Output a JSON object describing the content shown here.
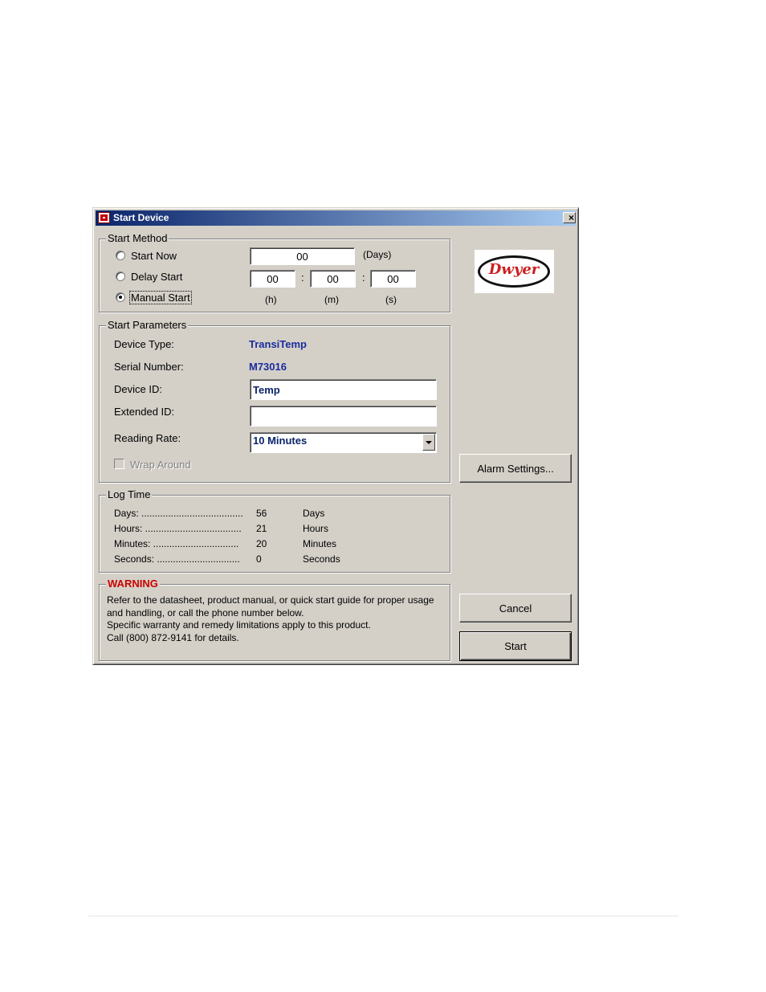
{
  "window": {
    "title": "Start Device",
    "close_label": "×"
  },
  "logo": {
    "text": "Dwyer"
  },
  "start_method": {
    "legend": "Start Method",
    "options": [
      {
        "label": "Start Now",
        "checked": false
      },
      {
        "label": "Delay Start",
        "checked": false
      },
      {
        "label": "Manual Start",
        "checked": true
      }
    ],
    "days_value": "00",
    "days_unit": "(Days)",
    "hours_value": "00",
    "minutes_value": "00",
    "seconds_value": "00",
    "colon": ":",
    "hours_unit": "(h)",
    "minutes_unit": "(m)",
    "seconds_unit": "(s)"
  },
  "start_parameters": {
    "legend": "Start Parameters",
    "device_type_label": "Device Type:",
    "device_type_value": "TransiTemp",
    "serial_label": "Serial Number:",
    "serial_value": "M73016",
    "device_id_label": "Device ID:",
    "device_id_value": "Temp",
    "extended_id_label": "Extended ID:",
    "extended_id_value": "",
    "reading_rate_label": "Reading Rate:",
    "reading_rate_value": "10 Minutes",
    "wrap_around_label": "Wrap Around"
  },
  "log_time": {
    "legend": "Log Time",
    "rows": [
      {
        "label": "Days: ......................................",
        "value": "56",
        "unit": "Days"
      },
      {
        "label": "Hours: ....................................",
        "value": "21",
        "unit": "Hours"
      },
      {
        "label": "Minutes: ................................",
        "value": "20",
        "unit": "Minutes"
      },
      {
        "label": "Seconds: ...............................",
        "value": "0",
        "unit": "Seconds"
      }
    ]
  },
  "warning": {
    "legend": "WARNING",
    "lines": [
      "Refer to the datasheet, product manual, or quick start guide for proper usage",
      "and handling, or call the phone number below.",
      "Specific warranty and remedy limitations apply to this product.",
      "Call (800) 872-9141 for details."
    ]
  },
  "buttons": {
    "alarm_settings": "Alarm Settings...",
    "cancel": "Cancel",
    "start": "Start"
  }
}
